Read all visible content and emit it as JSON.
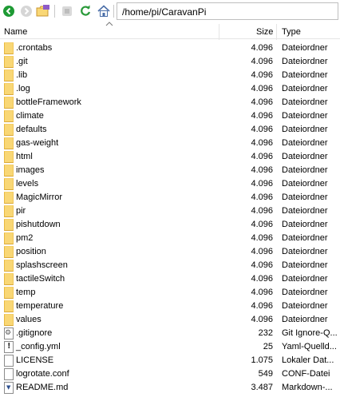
{
  "toolbar": {
    "path": "/home/pi/CaravanPi"
  },
  "columns": {
    "name": "Name",
    "size": "Size",
    "type": "Type"
  },
  "files": [
    {
      "name": ".crontabs",
      "size": "4.096",
      "type": "Dateiordner",
      "kind": "folder"
    },
    {
      "name": ".git",
      "size": "4.096",
      "type": "Dateiordner",
      "kind": "folder"
    },
    {
      "name": ".lib",
      "size": "4.096",
      "type": "Dateiordner",
      "kind": "folder"
    },
    {
      "name": ".log",
      "size": "4.096",
      "type": "Dateiordner",
      "kind": "folder"
    },
    {
      "name": "bottleFramework",
      "size": "4.096",
      "type": "Dateiordner",
      "kind": "folder"
    },
    {
      "name": "climate",
      "size": "4.096",
      "type": "Dateiordner",
      "kind": "folder"
    },
    {
      "name": "defaults",
      "size": "4.096",
      "type": "Dateiordner",
      "kind": "folder"
    },
    {
      "name": "gas-weight",
      "size": "4.096",
      "type": "Dateiordner",
      "kind": "folder"
    },
    {
      "name": "html",
      "size": "4.096",
      "type": "Dateiordner",
      "kind": "folder"
    },
    {
      "name": "images",
      "size": "4.096",
      "type": "Dateiordner",
      "kind": "folder"
    },
    {
      "name": "levels",
      "size": "4.096",
      "type": "Dateiordner",
      "kind": "folder"
    },
    {
      "name": "MagicMirror",
      "size": "4.096",
      "type": "Dateiordner",
      "kind": "folder"
    },
    {
      "name": "pir",
      "size": "4.096",
      "type": "Dateiordner",
      "kind": "folder"
    },
    {
      "name": "pishutdown",
      "size": "4.096",
      "type": "Dateiordner",
      "kind": "folder"
    },
    {
      "name": "pm2",
      "size": "4.096",
      "type": "Dateiordner",
      "kind": "folder"
    },
    {
      "name": "position",
      "size": "4.096",
      "type": "Dateiordner",
      "kind": "folder"
    },
    {
      "name": "splashscreen",
      "size": "4.096",
      "type": "Dateiordner",
      "kind": "folder"
    },
    {
      "name": "tactileSwitch",
      "size": "4.096",
      "type": "Dateiordner",
      "kind": "folder"
    },
    {
      "name": "temp",
      "size": "4.096",
      "type": "Dateiordner",
      "kind": "folder"
    },
    {
      "name": "temperature",
      "size": "4.096",
      "type": "Dateiordner",
      "kind": "folder"
    },
    {
      "name": "values",
      "size": "4.096",
      "type": "Dateiordner",
      "kind": "folder"
    },
    {
      "name": ".gitignore",
      "size": "232",
      "type": "Git Ignore-Q...",
      "kind": "gear"
    },
    {
      "name": "_config.yml",
      "size": "25",
      "type": "Yaml-Quelld...",
      "kind": "excl"
    },
    {
      "name": "LICENSE",
      "size": "1.075",
      "type": "Lokaler Dat...",
      "kind": "file"
    },
    {
      "name": "logrotate.conf",
      "size": "549",
      "type": "CONF-Datei",
      "kind": "file"
    },
    {
      "name": "README.md",
      "size": "3.487",
      "type": "Markdown-...",
      "kind": "md"
    }
  ],
  "colors": {
    "folder": "#f9d775",
    "accent": "#2d6db8"
  }
}
